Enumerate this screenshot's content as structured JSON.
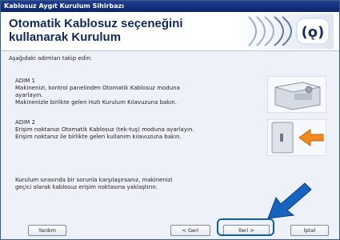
{
  "window": {
    "title": "Kablosuz Aygıt Kurulum Sihirbazı"
  },
  "header": {
    "title": "Otomatik Kablosuz seçeneğini kullanarak Kurulum",
    "logo_icon": "wifi-logo-icon"
  },
  "instruction": "Aşağıdaki adımları takip edin:",
  "steps": [
    {
      "title": "ADIM 1",
      "lines": [
        "Makinenizi, kontrol panelinden Otomatik Kablosuz moduna",
        "ayarlayın.",
        "Makinenizle birlikte gelen Hızlı Kurulum Kılavuzuna bakın."
      ]
    },
    {
      "title": "ADIM 2",
      "lines": [
        "Erişim noktanızı Otomatik Kablosuz (tek-tuş) moduna ayarlayın.",
        "Erişim noktanız ile birlikte gelen kullanım kılavuzuna bakın."
      ]
    }
  ],
  "note": {
    "lines": [
      "Kurulum sırasında bir sorunla karşılaşırsanız, makinenizi",
      "geçici olarak kablosuz erişim noktasına yaklaştırın."
    ]
  },
  "buttons": {
    "help": "Yardım",
    "back": "< Geri",
    "next": "İleri >",
    "cancel": "İptal"
  },
  "colors": {
    "accent": "#0d5fa8",
    "title_bar": "#0a246a",
    "arrow": "#1565c0"
  }
}
